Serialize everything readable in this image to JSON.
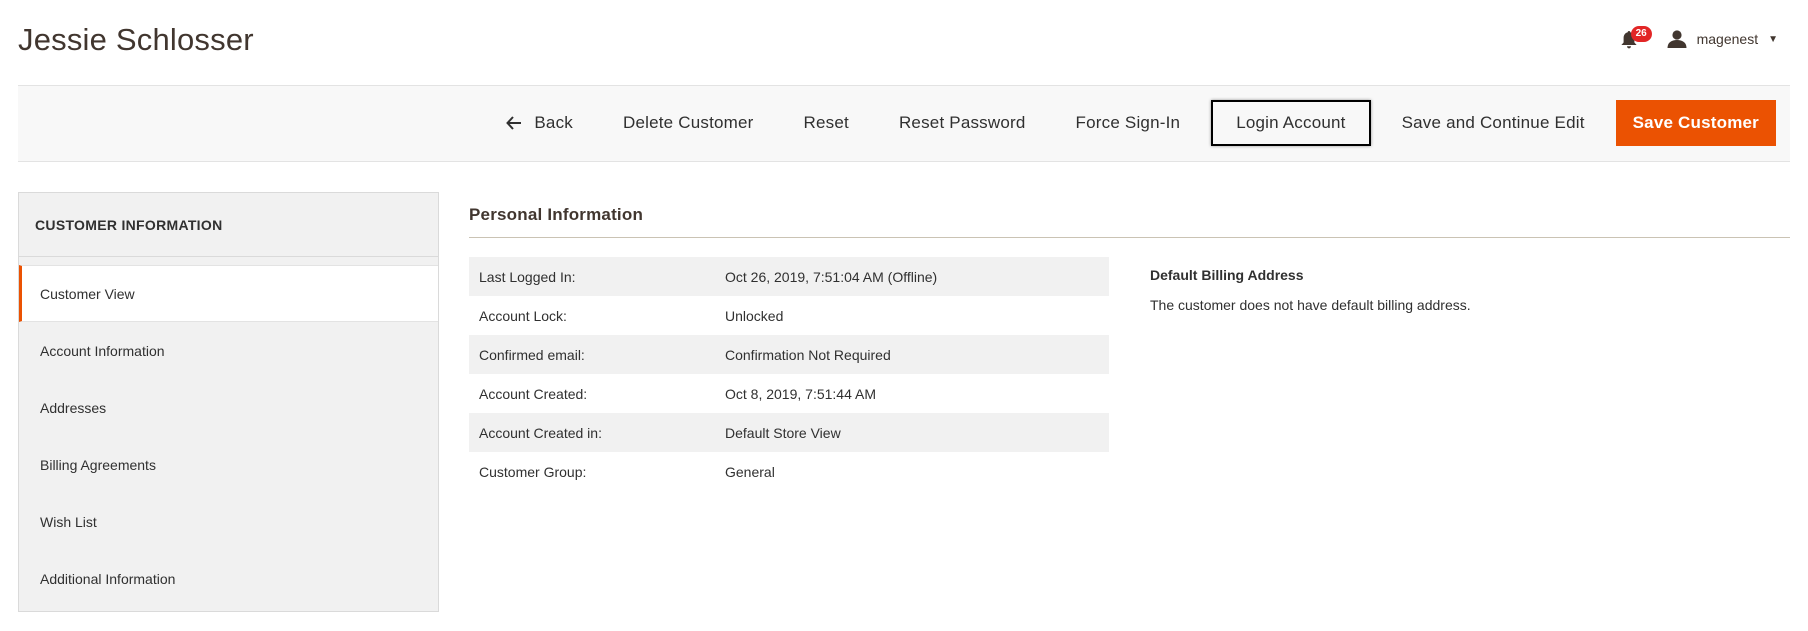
{
  "header": {
    "title": "Jessie Schlosser",
    "notification_count": "26",
    "username": "magenest"
  },
  "toolbar": {
    "back_label": "Back",
    "delete_label": "Delete Customer",
    "reset_label": "Reset",
    "reset_password_label": "Reset Password",
    "force_signin_label": "Force Sign-In",
    "login_account_label": "Login Account",
    "save_continue_label": "Save and Continue Edit",
    "save_label": "Save Customer"
  },
  "sidebar": {
    "title": "CUSTOMER INFORMATION",
    "items": [
      {
        "label": "Customer View"
      },
      {
        "label": "Account Information"
      },
      {
        "label": "Addresses"
      },
      {
        "label": "Billing Agreements"
      },
      {
        "label": "Wish List"
      },
      {
        "label": "Additional Information"
      }
    ]
  },
  "main": {
    "section_title": "Personal Information",
    "rows": [
      {
        "label": "Last Logged In:",
        "value": "Oct 26, 2019, 7:51:04 AM (Offline)"
      },
      {
        "label": "Account Lock:",
        "value": "Unlocked"
      },
      {
        "label": "Confirmed email:",
        "value": "Confirmation Not Required"
      },
      {
        "label": "Account Created:",
        "value": "Oct 8, 2019, 7:51:44 AM"
      },
      {
        "label": "Account Created in:",
        "value": "Default Store View"
      },
      {
        "label": "Customer Group:",
        "value": "General"
      }
    ],
    "billing_title": "Default Billing Address",
    "billing_text": "The customer does not have default billing address."
  },
  "colors": {
    "accent": "#eb5202",
    "badge": "#e22626"
  }
}
